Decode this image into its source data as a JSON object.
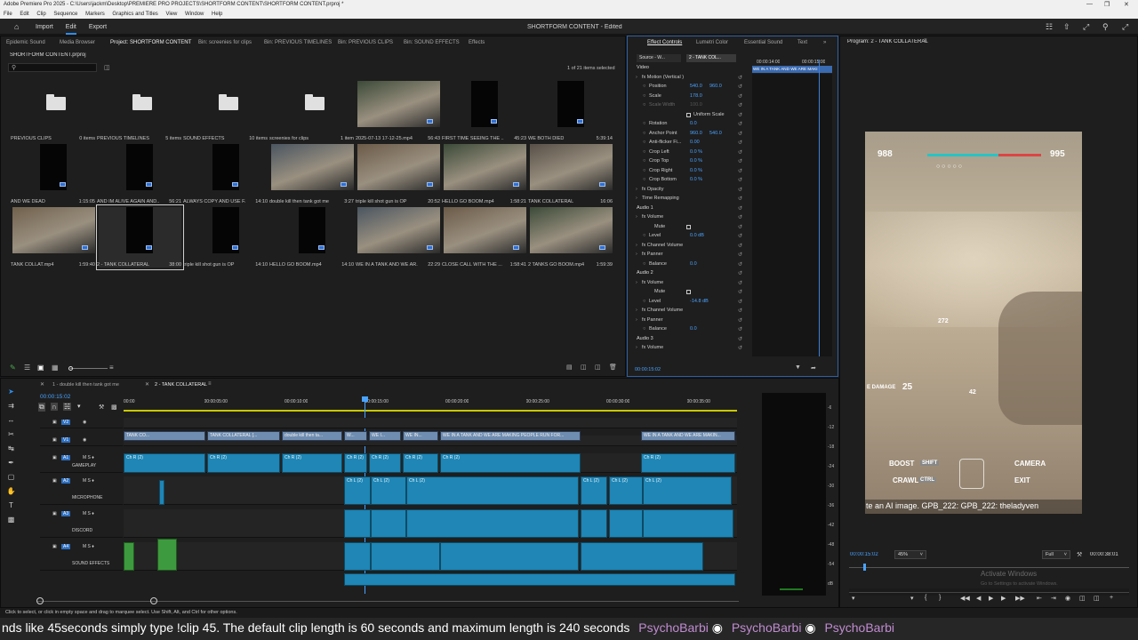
{
  "window": {
    "title": "Adobe Premiere Pro 2025 - C:\\Users\\jackm\\Desktop\\PREMIERE PRO PROJECTS\\SHORTFORM CONTENT\\SHORTFORM CONTENT.prproj *"
  },
  "menu": [
    "File",
    "Edit",
    "Clip",
    "Sequence",
    "Markers",
    "Graphics and Titles",
    "View",
    "Window",
    "Help"
  ],
  "header": {
    "nav": [
      "Import",
      "Edit",
      "Export"
    ],
    "active": "Edit",
    "project_title": "SHORTFORM CONTENT - Edited"
  },
  "project_panel": {
    "tabs": [
      "Epidemic Sound",
      "Media Browser",
      "Project: SHORTFORM CONTENT",
      "Bin: screenies for clips",
      "Bin: PREVIOUS TIMELINES",
      "Bin: PREVIOUS CLIPS",
      "Bin: SOUND EFFECTS",
      "Effects"
    ],
    "file": "SHORTFORM CONTENT.prproj",
    "selection": "1 of 21 items selected",
    "items": [
      {
        "name": "PREVIOUS CLIPS",
        "meta": "0 items",
        "kind": "folder"
      },
      {
        "name": "PREVIOUS TIMELINES",
        "meta": "5 items",
        "kind": "folder"
      },
      {
        "name": "SOUND EFFECTS",
        "meta": "10 items",
        "kind": "folder"
      },
      {
        "name": "screenies for clips",
        "meta": "1 item",
        "kind": "folder"
      },
      {
        "name": "2025-07-13 17-12-25.mp4",
        "meta": "56:43",
        "kind": "game"
      },
      {
        "name": "FIRST TIME SEEING THE ...",
        "meta": "45:23",
        "kind": "black"
      },
      {
        "name": "WE BOTH DIED",
        "meta": "5:39:14",
        "kind": "black"
      },
      {
        "name": "AND WE DEAD",
        "meta": "1:15:05",
        "kind": "black"
      },
      {
        "name": "AND IM ALIVE AGAIN AND...",
        "meta": "56:21",
        "kind": "black"
      },
      {
        "name": "ALWAYS COPY AND USE F...",
        "meta": "14:10",
        "kind": "black"
      },
      {
        "name": "double kill then tank got me",
        "meta": "3:27",
        "kind": "game"
      },
      {
        "name": "triple kill shot gun is OP",
        "meta": "20:52",
        "kind": "game"
      },
      {
        "name": "HELLO GO BOOM.mp4",
        "meta": "1:58:21",
        "kind": "game"
      },
      {
        "name": "TANK COLLATERAL",
        "meta": "16:06",
        "kind": "game"
      },
      {
        "name": "TANK COLLAT.mp4",
        "meta": "1:59:40",
        "kind": "game"
      },
      {
        "name": "2 - TANK COLLATERAL",
        "meta": "38:00",
        "kind": "black",
        "selected": true
      },
      {
        "name": "triple kill shot gun is OP",
        "meta": "14:10",
        "kind": "black"
      },
      {
        "name": "HELLO GO BOOM.mp4",
        "meta": "14:10",
        "kind": "black"
      },
      {
        "name": "WE IN A TANK AND WE AR...",
        "meta": "22:29",
        "kind": "game"
      },
      {
        "name": "CLOSE CALL WITH THE ...",
        "meta": "1:58:41",
        "kind": "game"
      },
      {
        "name": "2 TANKS GO BOOM.mp4",
        "meta": "1:59:39",
        "kind": "game"
      }
    ]
  },
  "effect_controls": {
    "tabs": [
      "Effect Controls",
      "Lumetri Color",
      "Essential Sound",
      "Text"
    ],
    "source_tab": "Source - W...",
    "seq_tab": "2 - TANK COL...",
    "time_start": "00:00:14:00",
    "time_end": "00:00:15:00",
    "clip_label": "WE IN A TANK AND WE ARE MAKI",
    "current_time": "00:00:15:02",
    "rows": [
      {
        "label": "Video",
        "type": "section"
      },
      {
        "label": "fx  Motion (Vertical )",
        "type": "group"
      },
      {
        "label": "Position",
        "values": [
          "540.0",
          "960.0"
        ]
      },
      {
        "label": "Scale",
        "values": [
          "178.0"
        ]
      },
      {
        "label": "Scale Width",
        "values": [
          "100.0"
        ],
        "dim": true
      },
      {
        "label": "Uniform Scale",
        "type": "check"
      },
      {
        "label": "Rotation",
        "values": [
          "0.0"
        ]
      },
      {
        "label": "Anchor Point",
        "values": [
          "960.0",
          "540.0"
        ]
      },
      {
        "label": "Anti-flicker Fi...",
        "values": [
          "0.00"
        ]
      },
      {
        "label": "Crop Left",
        "values": [
          "0.0 %"
        ]
      },
      {
        "label": "Crop Top",
        "values": [
          "0.0 %"
        ]
      },
      {
        "label": "Crop Right",
        "values": [
          "0.0 %"
        ]
      },
      {
        "label": "Crop Bottom",
        "values": [
          "0.0 %"
        ]
      },
      {
        "label": "fx  Opacity",
        "type": "group"
      },
      {
        "label": "Time Remapping",
        "type": "group"
      },
      {
        "label": "Audio 1",
        "type": "section"
      },
      {
        "label": "fx  Volume",
        "type": "group"
      },
      {
        "label": "Mute",
        "type": "check"
      },
      {
        "label": "Level",
        "values": [
          "0.0 dB"
        ]
      },
      {
        "label": "fx  Channel Volume",
        "type": "group"
      },
      {
        "label": "fx  Panner",
        "type": "group"
      },
      {
        "label": "Balance",
        "values": [
          "0.0"
        ]
      },
      {
        "label": "Audio 2",
        "type": "section"
      },
      {
        "label": "fx  Volume",
        "type": "group"
      },
      {
        "label": "Mute",
        "type": "check"
      },
      {
        "label": "Level",
        "values": [
          "-14.8 dB"
        ]
      },
      {
        "label": "fx  Channel Volume",
        "type": "group"
      },
      {
        "label": "fx  Panner",
        "type": "group"
      },
      {
        "label": "Balance",
        "values": [
          "0.0"
        ]
      },
      {
        "label": "Audio 3",
        "type": "section"
      },
      {
        "label": "fx  Volume",
        "type": "group"
      }
    ]
  },
  "program": {
    "title": "Program: 2 - TANK COLLATERAL",
    "timecode": "00:00:15:02",
    "zoom": "45%",
    "quality": "Full",
    "duration": "00:00:38:01",
    "hud": {
      "left_score": "988",
      "right_score": "995",
      "dist": "272",
      "damage_label": "E DAMAGE",
      "damage": "25",
      "boost": "BOOST",
      "shift": "SHIFT",
      "crawl": "CRAWL",
      "ctrl": "CTRL",
      "camera": "CAMERA",
      "exit": "EXIT",
      "n42": "42"
    },
    "chat": "te an AI image. GPB_222: GPB_222: theladyven",
    "watermark1": "Activate Windows",
    "watermark2": "Go to Settings to activate Windows."
  },
  "timeline": {
    "tabs": [
      "1 - double kill then tank got me",
      "2 - TANK COLLATERAL"
    ],
    "timecode": "00:00:15:02",
    "ruler": [
      "00:00",
      "00:00:05:00",
      "00:00:10:00",
      "00:00:15:00",
      "00:00:20:00",
      "00:00:25:00",
      "00:00:30:00",
      "00:00:35:00"
    ],
    "tracks": [
      {
        "id": "V2"
      },
      {
        "id": "V1"
      },
      {
        "id": "A1",
        "name": "GAMEPLAY"
      },
      {
        "id": "A2",
        "name": "MICROPHONE"
      },
      {
        "id": "A3",
        "name": "DISCORD"
      },
      {
        "id": "A4",
        "name": "SOUND EFFECTS"
      }
    ],
    "video_clips": [
      "TANK CO...",
      "TANK COLLATERAL [...",
      "double kill then ta...",
      "W...",
      "WE I...",
      "WE IN...",
      "WE IN A TANK AND WE ARE MAKING PEOPLE RUN FOR...",
      "WE IN A TANK AND WE ARE MAKIN..."
    ],
    "chan_l": "Ch L (2)",
    "chan_r": "Ch R (2)",
    "meter": [
      "-6",
      "-12",
      "-18",
      "-24",
      "-30",
      "-36",
      "-42",
      "-48",
      "-54",
      "dB"
    ]
  },
  "status": "Click to select, or click in empty space and drag to marquee select. Use Shift, Alt, and Ctrl for other options.",
  "ticker": "nds like 45seconds simply type !clip 45. The default clip length is 60 seconds and maximum length is 240 seconds",
  "ticker_names": [
    "PsychoBarbi",
    "PsychoBarbi",
    "PsychoBarbi"
  ]
}
